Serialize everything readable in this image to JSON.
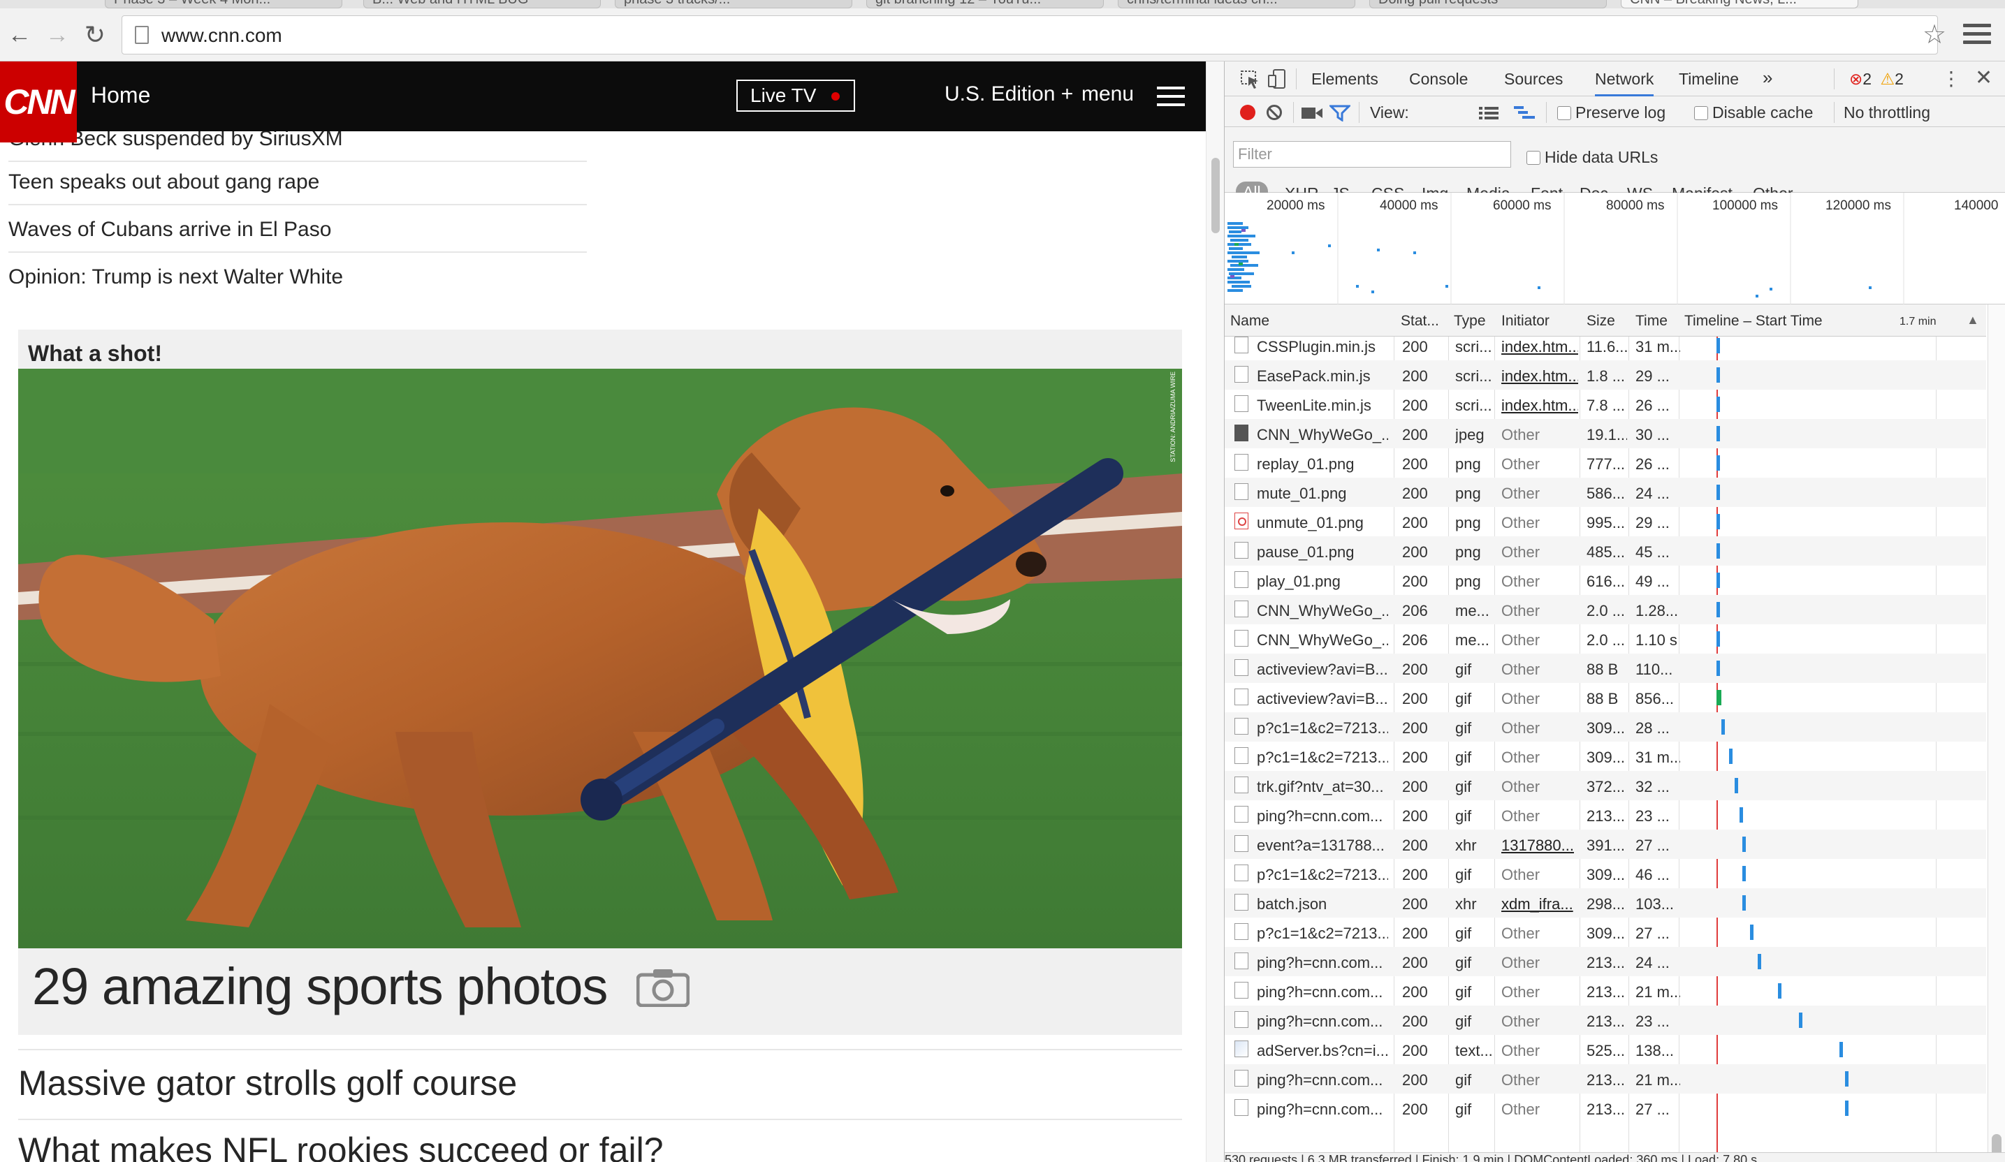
{
  "browser": {
    "tabs": [
      "Phase 3 – Week 4 Mon...",
      "B... Web and HTML BUG",
      "phase 3 tracks/...",
      "git branching 12 – YouTu...",
      "chris/terminal ideas ch...",
      "Doing pull requests",
      "CNN – Breaking News, L..."
    ],
    "url": "www.cnn.com",
    "icons": {
      "back": "back-arrow-icon",
      "forward": "forward-arrow-icon",
      "reload": "reload-icon",
      "star": "bookmark-star-icon",
      "menu": "hamburger-icon"
    }
  },
  "cnn": {
    "logo": "CNN",
    "nav": {
      "home": "Home",
      "live_tv": "Live TV",
      "edition": "U.S. Edition +",
      "menu": "menu"
    },
    "headlines": [
      "Glenn Beck suspended by SiriusXM",
      "Teen speaks out about gang rape",
      "Waves of Cubans arrive in El Paso",
      "Opinion: Trump is next Walter White"
    ],
    "card": {
      "title": "What a shot!",
      "photo_credit": "STATION: ANDRIA/ZUMA WIRE",
      "gallery": "29 amazing sports photos"
    },
    "stories": [
      "Massive gator strolls golf course",
      "What makes NFL rookies succeed or fail?"
    ],
    "colors": {
      "brand_red": "#cc0000",
      "nav_bg": "#0c0c0c"
    }
  },
  "devtools": {
    "tabs": [
      "Elements",
      "Console",
      "Sources",
      "Network",
      "Timeline"
    ],
    "active_tab": "Network",
    "more": "»",
    "errors": "2",
    "warnings": "2",
    "toolbar": {
      "view_label": "View:",
      "preserve_log": "Preserve log",
      "disable_cache": "Disable cache",
      "throttling": "No throttling"
    },
    "filter": {
      "placeholder": "Filter",
      "hide_data_urls": "Hide data URLs"
    },
    "resource_types": [
      "All",
      "XHR",
      "JS",
      "CSS",
      "Img",
      "Media",
      "Font",
      "Doc",
      "WS",
      "Manifest",
      "Other"
    ],
    "overview_ticks": [
      "20000 ms",
      "40000 ms",
      "60000 ms",
      "80000 ms",
      "100000 ms",
      "120000 ms",
      "140000"
    ],
    "columns": {
      "name": "Name",
      "status": "Stat...",
      "type": "Type",
      "initiator": "Initiator",
      "size": "Size",
      "time": "Time",
      "waterfall": "Timeline – Start Time",
      "scale": "1.7 min"
    },
    "rows": [
      {
        "icon": "file",
        "name": "CSSPlugin.min.js",
        "status": "200",
        "type": "scri...",
        "initiator": "index.htm...",
        "init_kind": "link",
        "size": "11.6...",
        "time": "31 m...",
        "bar": 0.07
      },
      {
        "icon": "file",
        "name": "EasePack.min.js",
        "status": "200",
        "type": "scri...",
        "initiator": "index.htm...",
        "init_kind": "link",
        "size": "1.8 ...",
        "time": "29 ...",
        "bar": 0.07
      },
      {
        "icon": "file",
        "name": "TweenLite.min.js",
        "status": "200",
        "type": "scri...",
        "initiator": "index.htm...",
        "init_kind": "link",
        "size": "7.8 ...",
        "time": "26 ...",
        "bar": 0.07
      },
      {
        "icon": "image",
        "name": "CNN_WhyWeGo_...",
        "status": "200",
        "type": "jpeg",
        "initiator": "Other",
        "init_kind": "other",
        "size": "19.1...",
        "time": "30 ...",
        "bar": 0.07
      },
      {
        "icon": "file",
        "name": "replay_01.png",
        "status": "200",
        "type": "png",
        "initiator": "Other",
        "init_kind": "other",
        "size": "777...",
        "time": "26 ...",
        "bar": 0.07
      },
      {
        "icon": "file",
        "name": "mute_01.png",
        "status": "200",
        "type": "png",
        "initiator": "Other",
        "init_kind": "other",
        "size": "586...",
        "time": "24 ...",
        "bar": 0.07
      },
      {
        "icon": "error",
        "name": "unmute_01.png",
        "status": "200",
        "type": "png",
        "initiator": "Other",
        "init_kind": "other",
        "size": "995...",
        "time": "29 ...",
        "bar": 0.07
      },
      {
        "icon": "file",
        "name": "pause_01.png",
        "status": "200",
        "type": "png",
        "initiator": "Other",
        "init_kind": "other",
        "size": "485...",
        "time": "45 ...",
        "bar": 0.07
      },
      {
        "icon": "file",
        "name": "play_01.png",
        "status": "200",
        "type": "png",
        "initiator": "Other",
        "init_kind": "other",
        "size": "616...",
        "time": "49 ...",
        "bar": 0.07
      },
      {
        "icon": "file",
        "name": "CNN_WhyWeGo_...",
        "status": "206",
        "type": "me...",
        "initiator": "Other",
        "init_kind": "other",
        "size": "2.0 ...",
        "time": "1.28...",
        "bar": 0.07
      },
      {
        "icon": "file",
        "name": "CNN_WhyWeGo_...",
        "status": "206",
        "type": "me...",
        "initiator": "Other",
        "init_kind": "other",
        "size": "2.0 ...",
        "time": "1.10 s",
        "bar": 0.07
      },
      {
        "icon": "file",
        "name": "activeview?avi=B...",
        "status": "200",
        "type": "gif",
        "initiator": "Other",
        "init_kind": "other",
        "size": "88 B",
        "time": "110...",
        "bar": 0.07
      },
      {
        "icon": "file",
        "name": "activeview?avi=B...",
        "status": "200",
        "type": "gif",
        "initiator": "Other",
        "init_kind": "other",
        "size": "88 B",
        "time": "856...",
        "bar": 0.07,
        "green": true
      },
      {
        "icon": "file",
        "name": "p?c1=1&c2=7213...",
        "status": "200",
        "type": "gif",
        "initiator": "Other",
        "init_kind": "other",
        "size": "309...",
        "time": "28 ...",
        "bar": 0.09
      },
      {
        "icon": "file",
        "name": "p?c1=1&c2=7213...",
        "status": "200",
        "type": "gif",
        "initiator": "Other",
        "init_kind": "other",
        "size": "309...",
        "time": "31 m...",
        "bar": 0.12
      },
      {
        "icon": "file",
        "name": "trk.gif?ntv_at=30...",
        "status": "200",
        "type": "gif",
        "initiator": "Other",
        "init_kind": "other",
        "size": "372...",
        "time": "32 ...",
        "bar": 0.14
      },
      {
        "icon": "file",
        "name": "ping?h=cnn.com...",
        "status": "200",
        "type": "gif",
        "initiator": "Other",
        "init_kind": "other",
        "size": "213...",
        "time": "23 ...",
        "bar": 0.16
      },
      {
        "icon": "file",
        "name": "event?a=131788...",
        "status": "200",
        "type": "xhr",
        "initiator": "1317880...",
        "init_kind": "link",
        "size": "391...",
        "time": "27 ...",
        "bar": 0.17
      },
      {
        "icon": "file",
        "name": "p?c1=1&c2=7213...",
        "status": "200",
        "type": "gif",
        "initiator": "Other",
        "init_kind": "other",
        "size": "309...",
        "time": "46 ...",
        "bar": 0.17
      },
      {
        "icon": "file",
        "name": "batch.json",
        "status": "200",
        "type": "xhr",
        "initiator": "xdm_ifra...",
        "init_kind": "link",
        "size": "298...",
        "time": "103...",
        "bar": 0.17
      },
      {
        "icon": "file",
        "name": "p?c1=1&c2=7213...",
        "status": "200",
        "type": "gif",
        "initiator": "Other",
        "init_kind": "other",
        "size": "309...",
        "time": "27 ...",
        "bar": 0.2
      },
      {
        "icon": "file",
        "name": "ping?h=cnn.com...",
        "status": "200",
        "type": "gif",
        "initiator": "Other",
        "init_kind": "other",
        "size": "213...",
        "time": "24 ...",
        "bar": 0.23
      },
      {
        "icon": "file",
        "name": "ping?h=cnn.com...",
        "status": "200",
        "type": "gif",
        "initiator": "Other",
        "init_kind": "other",
        "size": "213...",
        "time": "21 m...",
        "bar": 0.31
      },
      {
        "icon": "file",
        "name": "ping?h=cnn.com...",
        "status": "200",
        "type": "gif",
        "initiator": "Other",
        "init_kind": "other",
        "size": "213...",
        "time": "23 ...",
        "bar": 0.39
      },
      {
        "icon": "json",
        "name": "adServer.bs?cn=i...",
        "status": "200",
        "type": "text...",
        "initiator": "Other",
        "init_kind": "other",
        "size": "525...",
        "time": "138...",
        "bar": 0.55
      },
      {
        "icon": "file",
        "name": "ping?h=cnn.com...",
        "status": "200",
        "type": "gif",
        "initiator": "Other",
        "init_kind": "other",
        "size": "213...",
        "time": "21 m...",
        "bar": 0.57
      },
      {
        "icon": "file",
        "name": "ping?h=cnn.com...",
        "status": "200",
        "type": "gif",
        "initiator": "Other",
        "init_kind": "other",
        "size": "213...",
        "time": "27 ...",
        "bar": 0.57
      }
    ],
    "status_bar": "530 requests  |  6.3 MB transferred  |  Finish: 1.9 min  |  DOMContentLoaded: 360 ms  |  Load: 7.80 s",
    "colors": {
      "accent": "#3879d9",
      "bar": "#2a8de0",
      "record": "#e0201c",
      "load_line": "#e03c3c"
    }
  }
}
